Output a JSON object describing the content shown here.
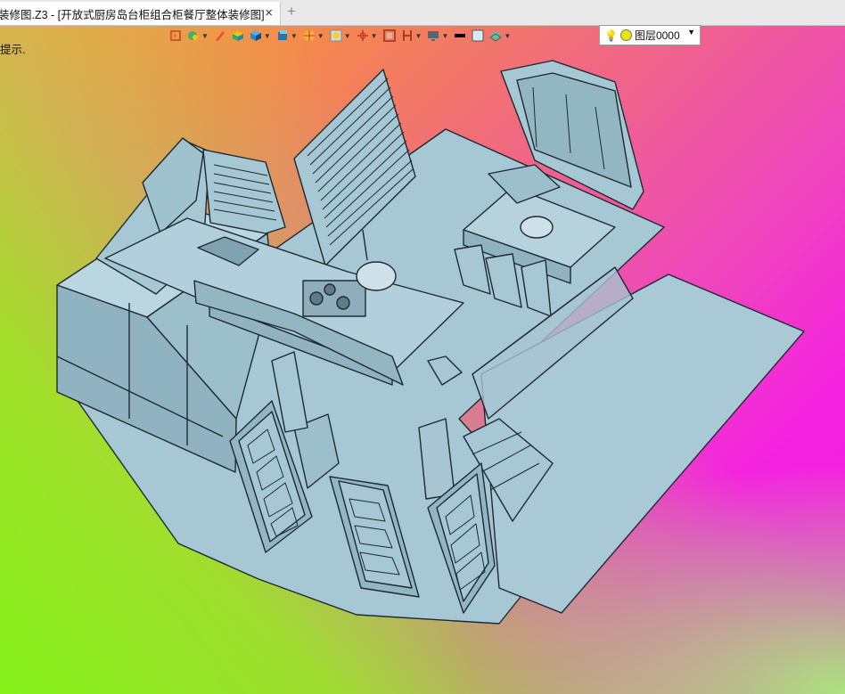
{
  "tab": {
    "title": "装修图.Z3 - [开放式厨房岛台柜组合柜餐厅整体装修图]",
    "close_icon": "×",
    "new_tab_icon": "+"
  },
  "toolbar": {
    "icons": [
      "import-icon",
      "paint-icon",
      "brush-icon",
      "box-icon",
      "cube-icon",
      "shaded-cube-icon",
      "render-icon",
      "material-icon",
      "snap-icon",
      "frame-icon",
      "section-icon",
      "display-icon",
      "line-color-icon",
      "fill-color-icon",
      "layer-fill-icon"
    ],
    "layer": {
      "name": "图层0000",
      "bulb_icon": "bulb-icon"
    }
  },
  "prompt": {
    "text": "提示."
  },
  "colors": {
    "model": "#a3c6d3",
    "edge": "#1e2a30"
  }
}
